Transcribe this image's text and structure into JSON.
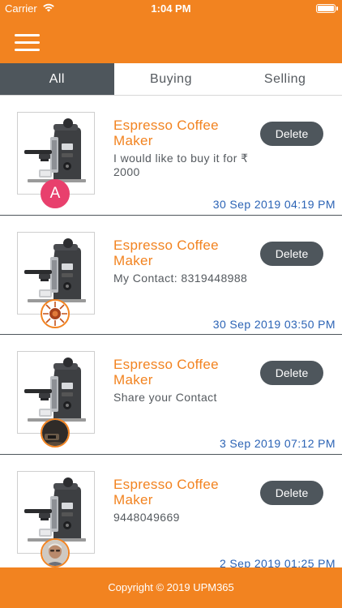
{
  "status_bar": {
    "carrier": "Carrier",
    "time": "1:04 PM"
  },
  "header": {
    "menu_icon": "hamburger-menu-icon"
  },
  "tabs": [
    {
      "label": "All",
      "active": true
    },
    {
      "label": "Buying",
      "active": false
    },
    {
      "label": "Selling",
      "active": false
    }
  ],
  "items": [
    {
      "title": "Espresso Coffee Maker",
      "message": "I would like to buy it for ₹ 2000",
      "delete_label": "Delete",
      "timestamp": "30 Sep 2019 04:19 PM",
      "avatar": {
        "type": "letter",
        "letter": "A"
      }
    },
    {
      "title": "Espresso Coffee Maker",
      "message": "My Contact: 8319448988",
      "delete_label": "Delete",
      "timestamp": "30 Sep 2019 03:50 PM",
      "avatar": {
        "type": "image",
        "icon": "sunburst-avatar-icon"
      }
    },
    {
      "title": "Espresso Coffee Maker",
      "message": "Share your Contact",
      "delete_label": "Delete",
      "timestamp": "3 Sep 2019 07:12 PM",
      "avatar": {
        "type": "image",
        "icon": "dark-photo-avatar-icon"
      }
    },
    {
      "title": "Espresso Coffee Maker",
      "message": "9448049669",
      "delete_label": "Delete",
      "timestamp": "2 Sep 2019 01:25 PM",
      "avatar": {
        "type": "image",
        "icon": "person-photo-avatar-icon"
      }
    }
  ],
  "footer": {
    "text": "Copyright © 2019 UPM365"
  },
  "colors": {
    "brand_orange": "#f28320",
    "dark_slate": "#4e565c",
    "timestamp_blue": "#2b63b5",
    "avatar_pink": "#e8406d"
  }
}
